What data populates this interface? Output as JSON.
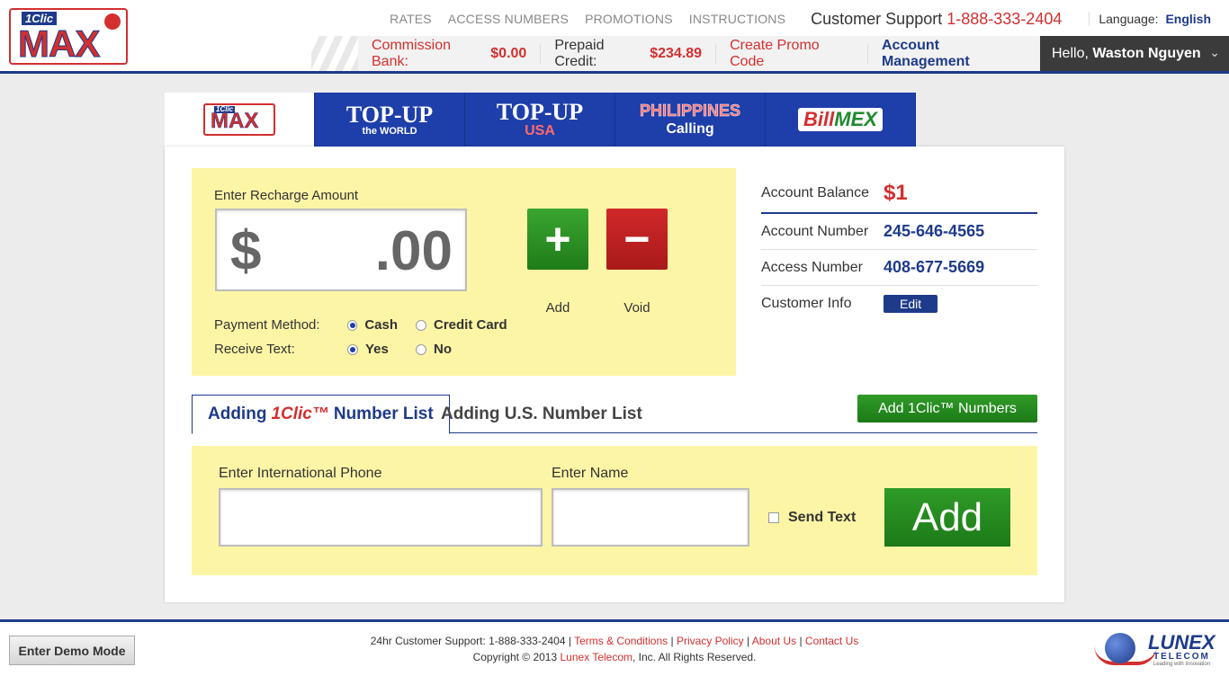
{
  "header": {
    "logo": {
      "clic": "1Clic",
      "max": "MAX"
    },
    "nav": [
      "RATES",
      "ACCESS NUMBERS",
      "PROMOTIONS",
      "INSTRUCTIONS"
    ],
    "support_label": "Customer Support",
    "support_phone": "1-888-333-2404",
    "language_label": "Language:",
    "language_value": "English",
    "commission_label": "Commission Bank:",
    "commission_value": "$0.00",
    "prepaid_label": "Prepaid Credit:",
    "prepaid_value": "$234.89",
    "promo_label": "Create Promo Code",
    "account_mgmt_label": "Account Management",
    "hello_label": "Hello,",
    "user_name": "Waston Nguyen"
  },
  "brand_tabs": {
    "max_logo": {
      "clic": "1Clic",
      "max": "MAX"
    },
    "topup_world": {
      "line1": "TOP-UP",
      "line2": "the WORLD"
    },
    "topup_usa": {
      "line1": "TOP-UP",
      "line2": "USA"
    },
    "philippines": {
      "line1": "PHILIPPINES",
      "line2": "Calling"
    },
    "billmex": {
      "part1": "Bill",
      "part2": "MEX"
    }
  },
  "recharge": {
    "label": "Enter Recharge Amount",
    "currency": "$",
    "cents": ".00",
    "add_symbol": "+",
    "void_symbol": "−",
    "add_label": "Add",
    "void_label": "Void",
    "payment_label": "Payment Method:",
    "payment_options": [
      "Cash",
      "Credit Card"
    ],
    "receive_label": "Receive Text:",
    "receive_options": [
      "Yes",
      "No"
    ]
  },
  "account": {
    "balance_label": "Account Balance",
    "balance_value": "$1",
    "number_label": "Account Number",
    "number_value": "245-646-4565",
    "access_label": "Access Number",
    "access_value": "408-677-5669",
    "customer_label": "Customer Info",
    "edit_label": "Edit"
  },
  "list_tabs": {
    "tab1_prefix": "Adding",
    "tab1_brand": "1Clic™",
    "tab1_suffix": "Number List",
    "tab2": "Adding U.S. Number List",
    "add_numbers_button": "Add 1Clic™ Numbers"
  },
  "add_form": {
    "phone_label": "Enter International Phone",
    "name_label": "Enter Name",
    "send_text_label": "Send Text",
    "add_button": "Add"
  },
  "footer": {
    "demo_button": "Enter Demo Mode",
    "support_text": "24hr Customer Support: 1-888-333-2404 |",
    "links": [
      "Terms & Conditions",
      "Privacy Policy",
      "About Us",
      "Contact Us"
    ],
    "copyright_prefix": "Copyright © 2013",
    "copyright_company": "Lunex Telecom",
    "copyright_suffix": ", Inc. All Rights Reserved.",
    "lunex_name": "LUNEX",
    "lunex_sub": "TELECOM",
    "lunex_tag": "Leading with Innovation"
  }
}
